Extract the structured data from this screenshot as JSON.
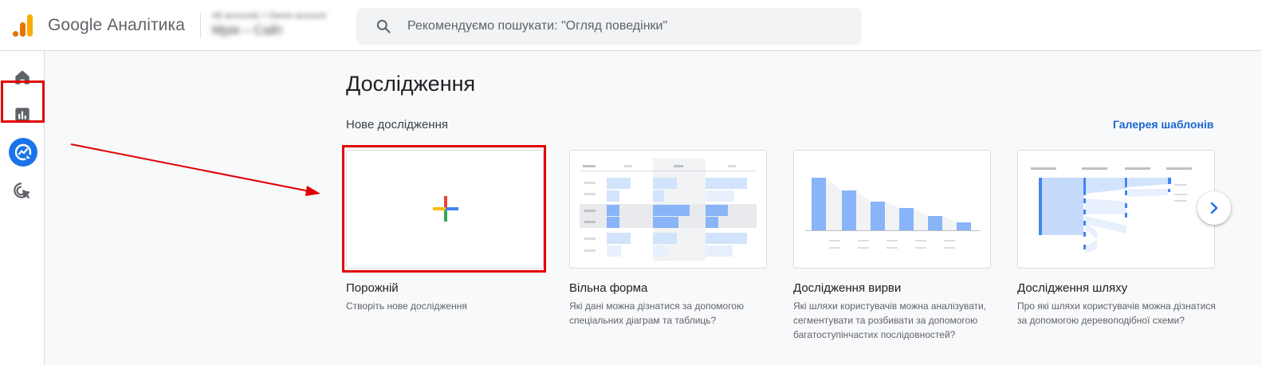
{
  "header": {
    "brand": "Google Аналітика",
    "account_line1": "All accounts > Demo account",
    "account_line2": "Мрія – Сайт",
    "search_placeholder": "Рекомендуємо пошукати: \"Огляд поведінки\""
  },
  "nav": {
    "items": [
      {
        "icon": "home-icon"
      },
      {
        "icon": "reports-icon"
      },
      {
        "icon": "explore-icon",
        "selected": true
      },
      {
        "icon": "advertising-icon"
      }
    ]
  },
  "main": {
    "title": "Дослідження",
    "section_label": "Нове дослідження",
    "gallery_link": "Галерея шаблонів",
    "cards": [
      {
        "title": "Порожній",
        "desc": "Створіть нове дослідження"
      },
      {
        "title": "Вільна форма",
        "desc": "Які дані можна дізнатися за допомогою спеціальних діаграм та таблиць?"
      },
      {
        "title": "Дослідження вирви",
        "desc": "Які шляхи користувачів можна аналізувати, сегментувати та розбивати за допомогою багатоступінчастих послідовностей?"
      },
      {
        "title": "Дослідження шляху",
        "desc": "Про які шляхи користувачів можна дізнатися за допомогою деревоподібної схеми?"
      }
    ]
  },
  "colors": {
    "accent": "#1a73e8",
    "annotation_red": "#e00000",
    "chart_blue": "#8ab4f8",
    "chart_light_blue": "#d2e3fc"
  }
}
